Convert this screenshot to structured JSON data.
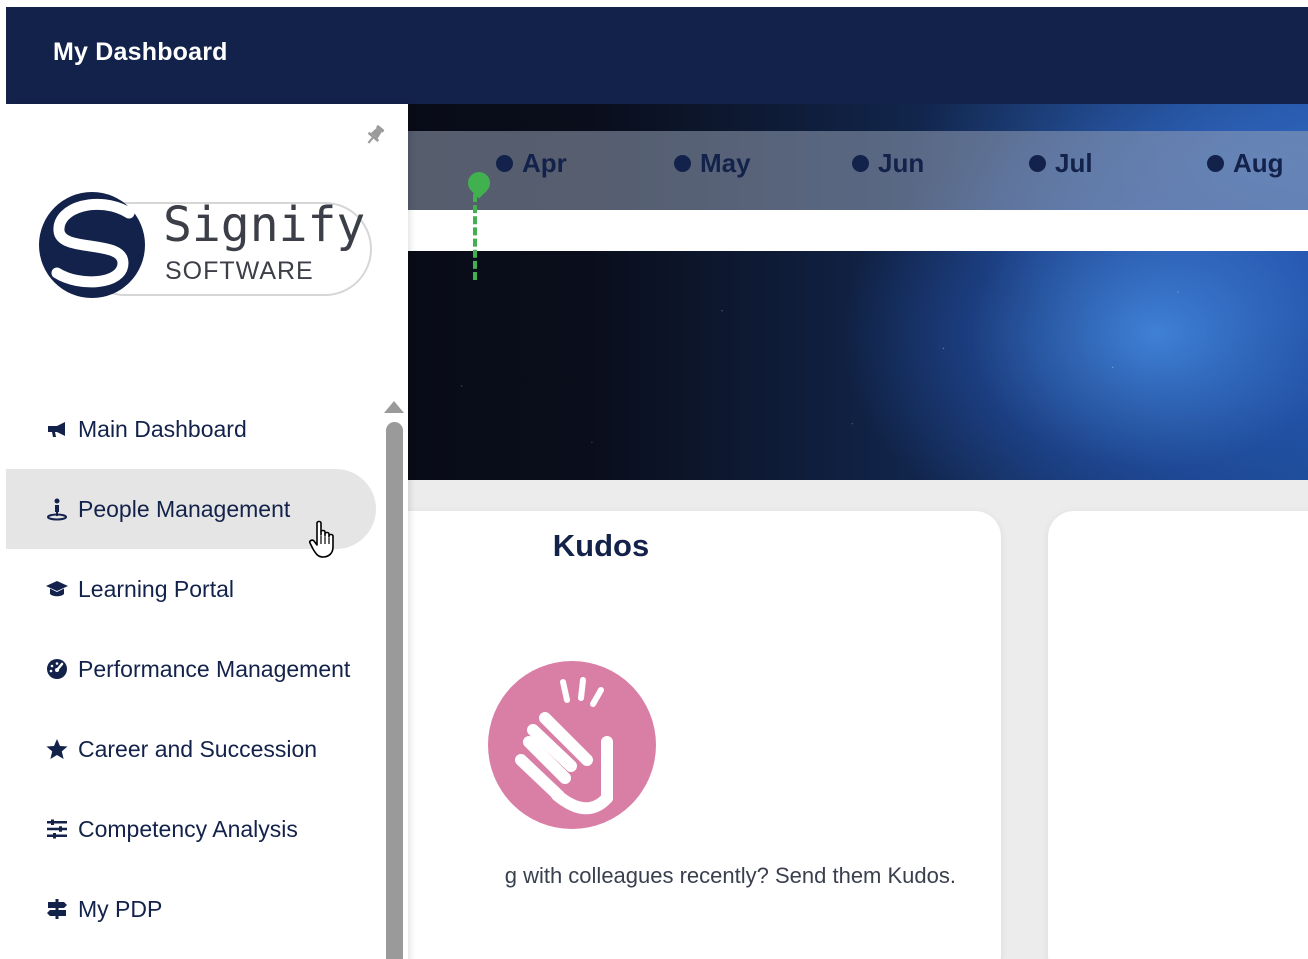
{
  "header": {
    "title": "My Dashboard"
  },
  "timeline": {
    "months": [
      "Apr",
      "May",
      "Jun",
      "Jul",
      "Aug"
    ],
    "marker_color": "#41b04f"
  },
  "logo": {
    "name": "Signify",
    "subtitle": "SOFTWARE"
  },
  "sidebar": {
    "items": [
      {
        "label": "Main Dashboard",
        "icon": "megaphone-icon",
        "active": false
      },
      {
        "label": "People Management",
        "icon": "person-location-icon",
        "active": true
      },
      {
        "label": "Learning Portal",
        "icon": "graduation-cap-icon",
        "active": false
      },
      {
        "label": "Performance Management",
        "icon": "gauge-icon",
        "active": false
      },
      {
        "label": "Career and Succession",
        "icon": "star-icon",
        "active": false
      },
      {
        "label": "Competency Analysis",
        "icon": "sliders-icon",
        "active": false
      },
      {
        "label": "My PDP",
        "icon": "signpost-icon",
        "active": false
      }
    ]
  },
  "kudos": {
    "title": "Kudos",
    "text": "g with colleagues recently? Send them Kudos.",
    "icon": "waving-hand-icon",
    "icon_color": "#d97fa6"
  },
  "colors": {
    "navy": "#13224b",
    "active_bg": "#e5e5e5"
  }
}
